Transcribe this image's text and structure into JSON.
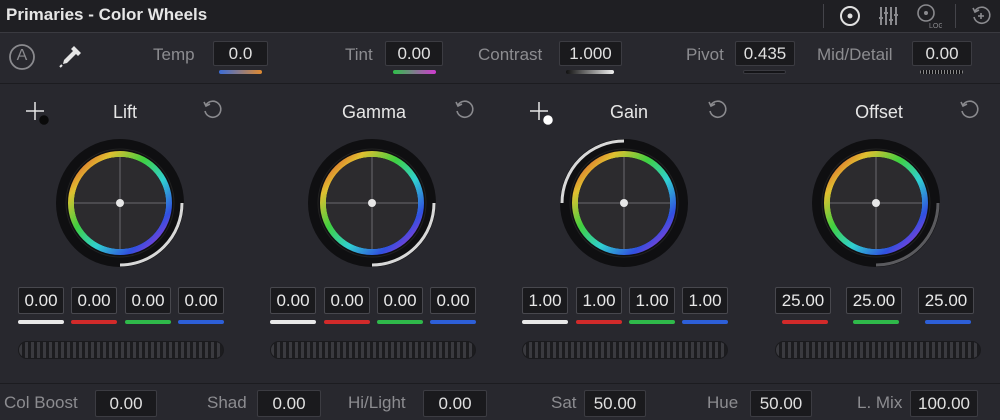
{
  "panel": {
    "title": "Primaries - Color Wheels"
  },
  "top_icons": [
    "primaries-wheels-icon",
    "primaries-bars-icon",
    "log-wheels-icon",
    "reset-all-icon"
  ],
  "toolbar": {
    "auto_label": "A",
    "temp_label": "Temp",
    "temp_value": "0.0",
    "tint_label": "Tint",
    "tint_value": "0.00",
    "contrast_label": "Contrast",
    "contrast_value": "1.000",
    "pivot_label": "Pivot",
    "pivot_value": "0.435",
    "middetail_label": "Mid/Detail",
    "middetail_value": "0.00"
  },
  "wheels": {
    "lift": {
      "title": "Lift",
      "values": [
        "0.00",
        "0.00",
        "0.00",
        "0.00"
      ]
    },
    "gamma": {
      "title": "Gamma",
      "values": [
        "0.00",
        "0.00",
        "0.00",
        "0.00"
      ]
    },
    "gain": {
      "title": "Gain",
      "values": [
        "1.00",
        "1.00",
        "1.00",
        "1.00"
      ]
    },
    "offset": {
      "title": "Offset",
      "values": [
        "25.00",
        "25.00",
        "25.00"
      ]
    }
  },
  "bottom": {
    "colboost_label": "Col Boost",
    "colboost_value": "0.00",
    "shad_label": "Shad",
    "shad_value": "0.00",
    "hilight_label": "Hi/Light",
    "hilight_value": "0.00",
    "sat_label": "Sat",
    "sat_value": "50.00",
    "hue_label": "Hue",
    "hue_value": "50.00",
    "lmix_label": "L. Mix",
    "lmix_value": "100.00"
  },
  "colors": {
    "bar_white": "#e8e8e8",
    "bar_red": "#d22a2a",
    "bar_green": "#2fb94a",
    "bar_blue": "#2d5fd8",
    "panel_bg": "#28282e",
    "field_bg": "#1a1a1d"
  }
}
